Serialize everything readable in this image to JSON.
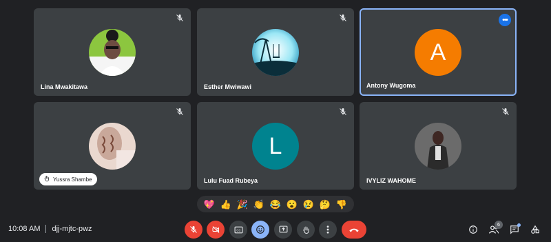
{
  "participants": [
    {
      "name": "Lina Mwakitawa",
      "avatar": "photo-woman-portrait",
      "muted": true
    },
    {
      "name": "Esther Mwiwawi",
      "avatar": "photo-tree-swing",
      "muted": true
    },
    {
      "name": "Antony Wugoma",
      "letter": "A",
      "color": "#f57c00",
      "muted": false,
      "active": true
    },
    {
      "name": "Yussra Shambe",
      "avatar": "photo-henna-hands",
      "muted": true,
      "hand_raised": true
    },
    {
      "name": "Lulu Fuad Rubeya",
      "letter": "L",
      "color": "#00838f",
      "muted": true
    },
    {
      "name": "IVYLIZ WAHOME",
      "avatar": "photo-person-standing",
      "muted": true
    }
  ],
  "reactions": [
    "💖",
    "👍",
    "🎉",
    "👏",
    "😂",
    "😮",
    "😢",
    "🤔",
    "👎"
  ],
  "meeting": {
    "time": "10:08 AM",
    "code": "djj-mjtc-pwz"
  },
  "people_count": "6",
  "colors": {
    "background": "#202124",
    "tile": "#3c4043",
    "accent": "#8ab4f8",
    "danger": "#ea4335"
  },
  "controls": [
    "mic-off-icon",
    "camera-off-icon",
    "captions-icon",
    "emoji-icon",
    "present-icon",
    "raise-hand-icon",
    "more-options-icon",
    "hang-up-icon"
  ],
  "right_controls": [
    "info-icon",
    "people-icon",
    "chat-icon",
    "activities-icon"
  ]
}
